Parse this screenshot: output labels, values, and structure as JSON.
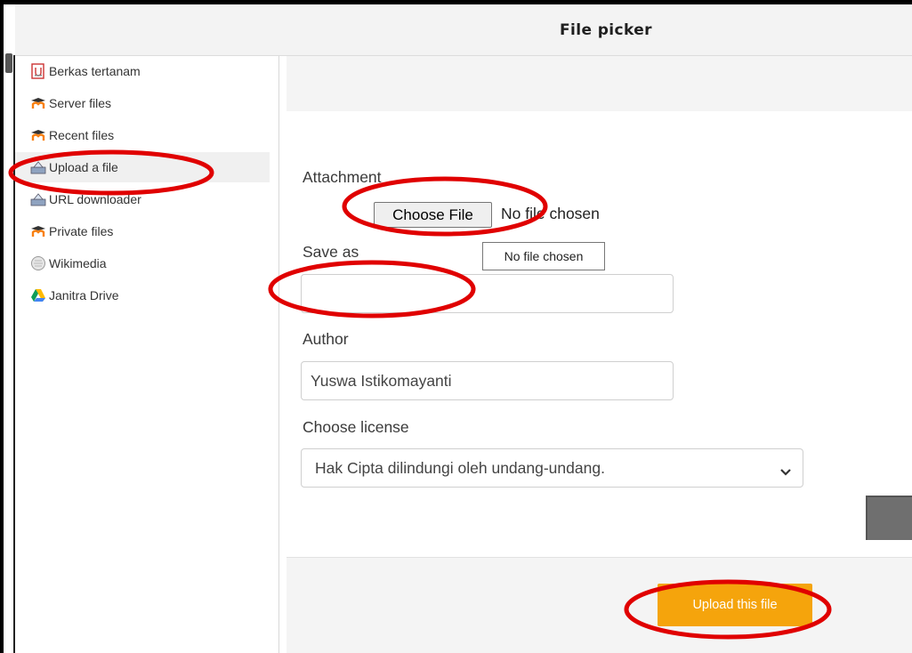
{
  "header": {
    "title": "File picker"
  },
  "sidebar": {
    "items": [
      {
        "label": "Berkas tertanam",
        "icon": "embedded-files-icon"
      },
      {
        "label": "Server files",
        "icon": "moodle-icon"
      },
      {
        "label": "Recent files",
        "icon": "moodle-icon"
      },
      {
        "label": "Upload a file",
        "icon": "upload-icon",
        "active": true
      },
      {
        "label": "URL downloader",
        "icon": "url-downloader-icon"
      },
      {
        "label": "Private files",
        "icon": "moodle-icon"
      },
      {
        "label": "Wikimedia",
        "icon": "wikimedia-icon"
      },
      {
        "label": "Janitra Drive",
        "icon": "google-drive-icon"
      }
    ]
  },
  "form": {
    "attachment_label": "Attachment",
    "choose_file_button": "Choose File",
    "no_file_text": "No file chosen",
    "tooltip_text": "No file chosen",
    "save_as_label": "Save as",
    "save_as_value": "",
    "author_label": "Author",
    "author_value": "Yuswa Istikomayanti",
    "license_label": "Choose license",
    "license_selected": "Hak Cipta dilindungi oleh undang-undang.",
    "upload_button": "Upload this file"
  },
  "colors": {
    "upload_button": "#f5a40c",
    "annotation_ellipse": "#e00000",
    "moodle_orange": "#f98012"
  }
}
